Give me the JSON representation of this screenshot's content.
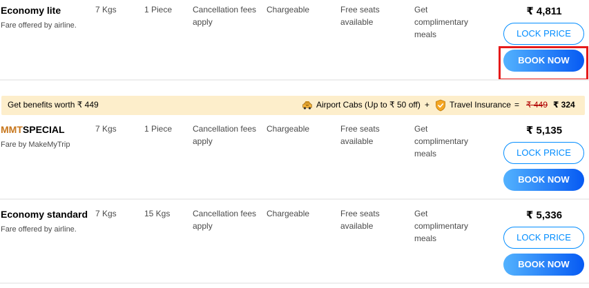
{
  "fares": [
    {
      "name": "Economy lite",
      "subtitle": "Fare offered by airline.",
      "cabin_bag": "7 Kgs",
      "checkin_bag": "1 Piece",
      "cancellation": "Cancellation fees apply",
      "date_change": "Chargeable",
      "seats": "Free seats available",
      "meals": "Get complimentary meals",
      "price": "₹ 4,811",
      "lock_label": "LOCK PRICE",
      "book_label": "BOOK NOW"
    },
    {
      "brand_prefix": "MMT",
      "brand_suffix": "SPECIAL",
      "subtitle": "Fare by MakeMyTrip",
      "cabin_bag": "7 Kgs",
      "checkin_bag": "1 Piece",
      "cancellation": "Cancellation fees apply",
      "date_change": "Chargeable",
      "seats": "Free seats available",
      "meals": "Get complimentary meals",
      "price": "₹ 5,135",
      "lock_label": "LOCK PRICE",
      "book_label": "BOOK NOW"
    },
    {
      "name": "Economy standard",
      "subtitle": "Fare offered by airline.",
      "cabin_bag": "7 Kgs",
      "checkin_bag": "15 Kgs",
      "cancellation": "Cancellation fees apply",
      "date_change": "Chargeable",
      "seats": "Free seats available",
      "meals": "Get complimentary meals",
      "price": "₹ 5,336",
      "lock_label": "LOCK PRICE",
      "book_label": "BOOK NOW"
    }
  ],
  "benefits": {
    "title": "Get benefits worth ₹ 449",
    "cab_label": "Airport Cabs (Up to ₹ 50 off)",
    "plus": "+",
    "insurance_label": "Travel Insurance",
    "equals": "=",
    "old_price": "₹ 449",
    "new_price": "₹ 324"
  },
  "colors": {
    "accent": "#008cff",
    "highlight": "#e51a1a",
    "benefits_bg": "#fdeecb",
    "mmt_brand": "#c7761b"
  },
  "icons": {
    "cab": "taxi-icon",
    "insurance": "shield-check-icon"
  }
}
